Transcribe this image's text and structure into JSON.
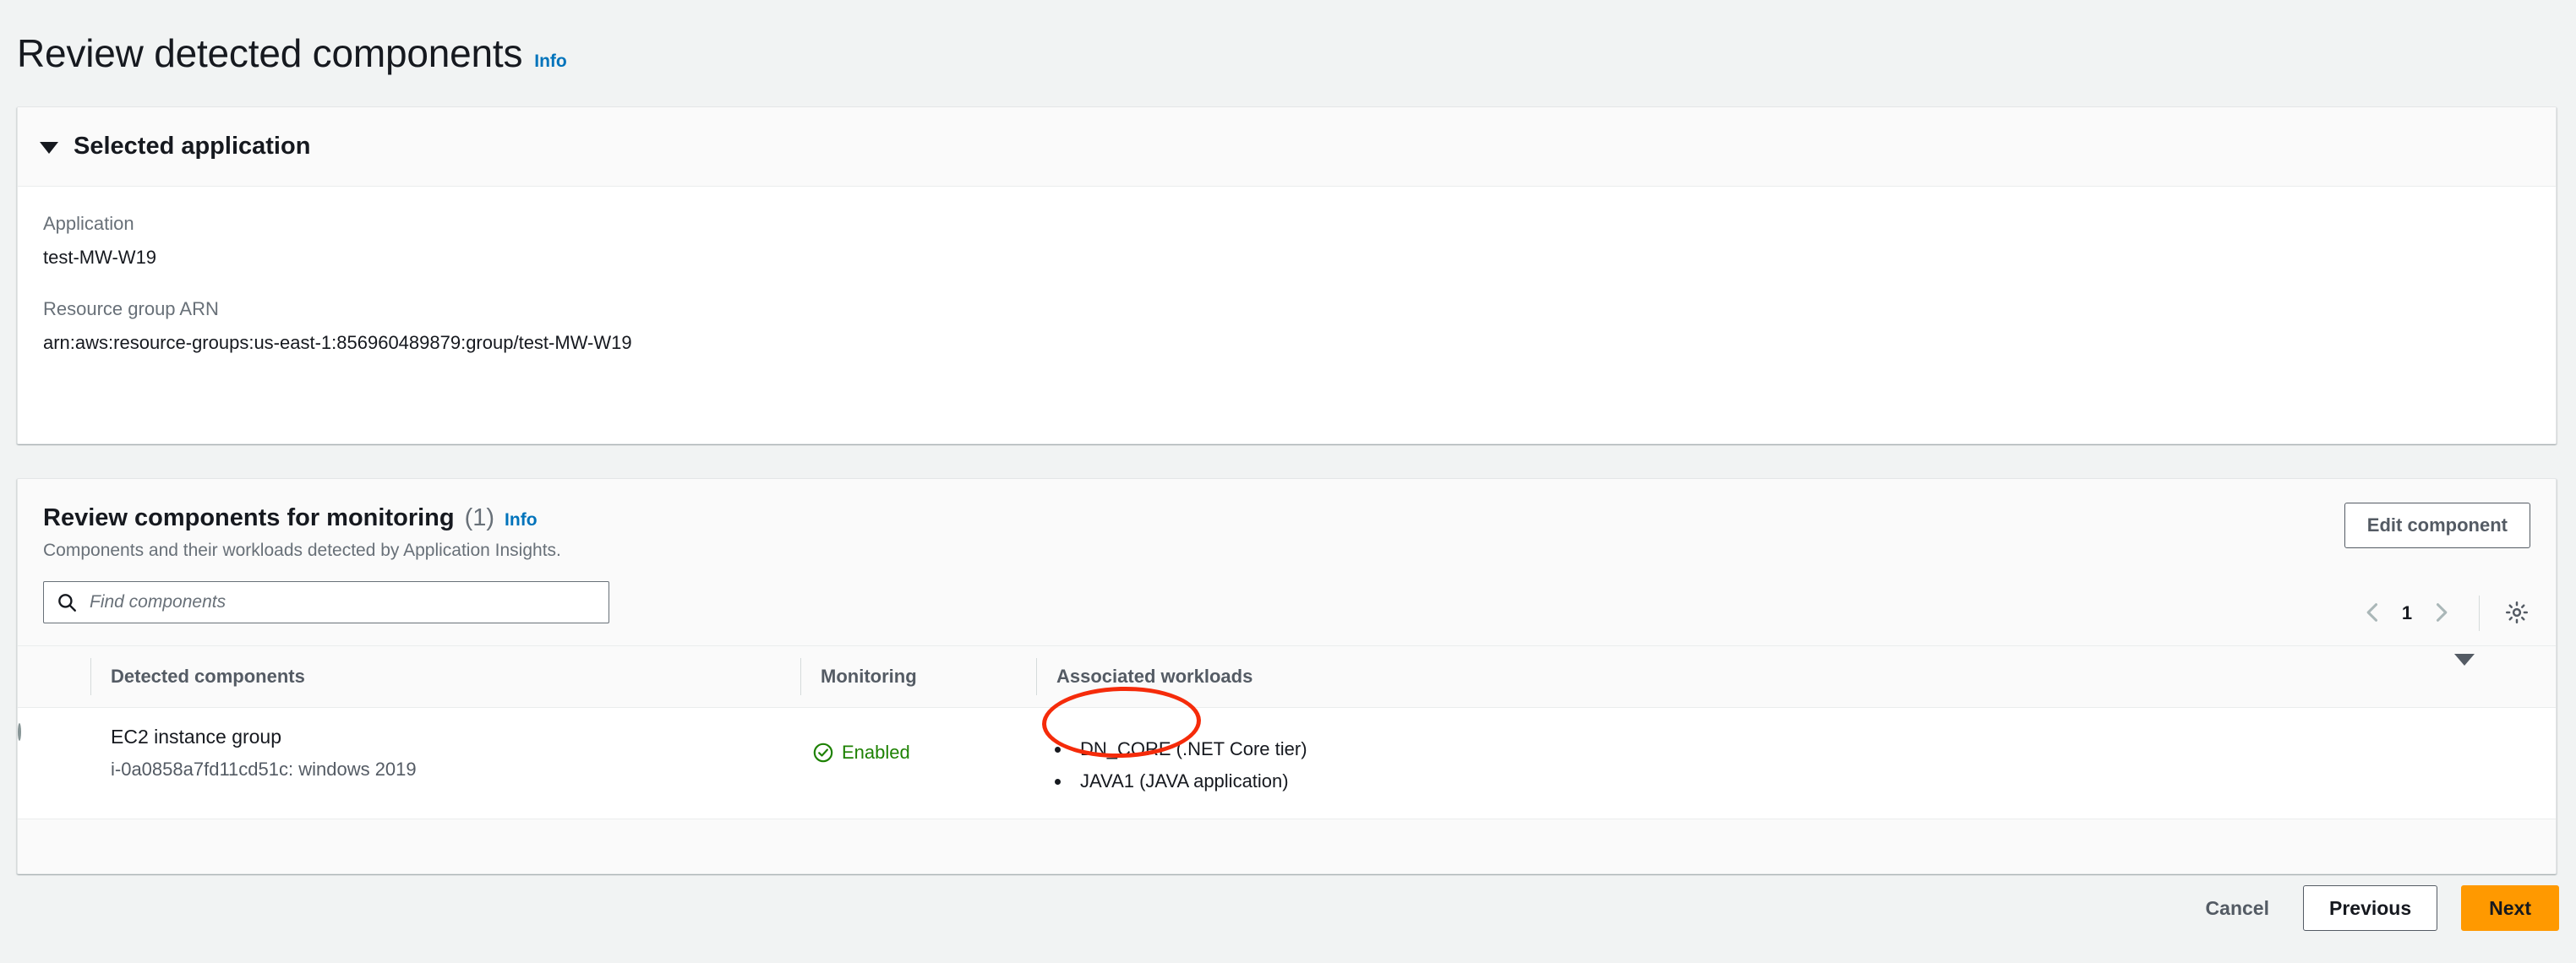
{
  "page": {
    "title": "Review detected components",
    "info_label": "Info"
  },
  "selected_application": {
    "section_title": "Selected application",
    "caret_icon": "caret-down-icon",
    "fields": [
      {
        "label": "Application",
        "value": "test-MW-W19"
      },
      {
        "label": "Resource group ARN",
        "value": "arn:aws:resource-groups:us-east-1:856960489879:group/test-MW-W19"
      }
    ]
  },
  "review_components": {
    "title": "Review components for monitoring",
    "count": "(1)",
    "info_label": "Info",
    "subtitle": "Components and their workloads detected by Application Insights.",
    "edit_button": "Edit component",
    "search": {
      "placeholder": "Find components",
      "value": "",
      "icon": "search-icon"
    },
    "pagination": {
      "previous_icon": "chevron-left-icon",
      "page": "1",
      "next_icon": "chevron-right-icon",
      "settings_icon": "gear-icon"
    },
    "table": {
      "columns": [
        "Detected components",
        "Monitoring",
        "Associated workloads"
      ],
      "sort_icon": "caret-down-icon",
      "rows": [
        {
          "selected": false,
          "component_name": "EC2 instance group",
          "component_detail": "i-0a0858a7fd11cd51c: windows 2019",
          "monitoring_status": "Enabled",
          "monitoring_icon": "check-circle-icon",
          "workloads": [
            "DN_CORE (.NET Core tier)",
            "JAVA1 (JAVA application)"
          ]
        }
      ]
    }
  },
  "footer": {
    "cancel_label": "Cancel",
    "previous_label": "Previous",
    "next_label": "Next"
  },
  "annotation": {
    "type": "red-ellipse-highlight",
    "target": "Associated workloads",
    "color": "#f52b0a"
  }
}
